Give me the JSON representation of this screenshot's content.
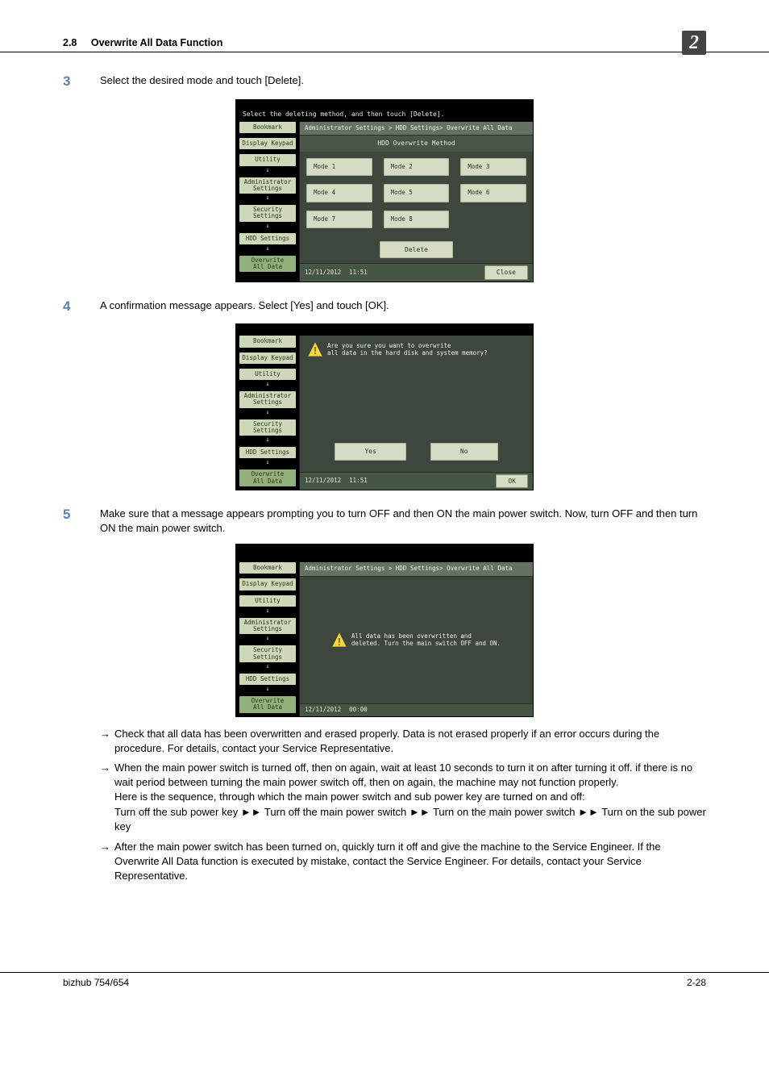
{
  "header": {
    "sec_number": "2.8",
    "sec_title": "Overwrite All Data Function",
    "badge": "2"
  },
  "steps": {
    "s3": {
      "num": "3",
      "text": "Select the desired mode and touch [Delete]."
    },
    "s4": {
      "num": "4",
      "text": "A confirmation message appears. Select [Yes] and touch [OK]."
    },
    "s5": {
      "num": "5",
      "text": "Make sure that a message appears prompting you to turn OFF and then ON the main power switch. Now, turn OFF and then turn ON the main power switch."
    }
  },
  "bullets": {
    "b1": "Check that all data has been overwritten and erased properly. Data is not erased properly if an error occurs during the procedure. For details, contact your Service Representative.",
    "b2a": "When the main power switch is turned off, then on again, wait at least 10 seconds to turn it on after turning it off. if there is no wait period between turning the main power switch off, then on again, the machine may not function properly.",
    "b2b": "Here is the sequence, through which the main power switch and sub power key are turned on and off:",
    "seq1": "Turn off the sub power key ",
    "seq2": " Turn off the main power switch ",
    "seq3": " Turn on the main power switch ",
    "seq4": " Turn on the sub power key",
    "b3": "After the main power switch has been turned on, quickly turn it off and give the machine to the Service Engineer. If the Overwrite All Data function is executed by mistake, contact the Service Engineer. For details, contact your Service Representative."
  },
  "screen1": {
    "instr": "Select the deleting method, and then touch [Delete].",
    "crumb": "Administrator Settings > HDD Settings> Overwrite All Data",
    "tab": "HDD Overwrite Method",
    "modes": [
      "Mode 1",
      "Mode 2",
      "Mode 3",
      "Mode 4",
      "Mode 5",
      "Mode 6",
      "Mode 7",
      "Mode 8"
    ],
    "delete": "Delete",
    "date": "12/11/2012",
    "time": "11:51",
    "close": "Close"
  },
  "side": {
    "bookmark": "Bookmark",
    "keypad": "Display Keypad",
    "utility": "Utility",
    "admin": "Administrator\nSettings",
    "security": "Security\nSettings",
    "hdd": "HDD Settings",
    "overwrite": "Overwrite\nAll Data"
  },
  "screen2": {
    "warn": "Are you sure you want to overwrite\nall data in the hard disk and system memory?",
    "yes": "Yes",
    "no": "No",
    "ok": "OK",
    "date": "12/11/2012",
    "time": "11:51"
  },
  "screen3": {
    "crumb": "Administrator Settings > HDD Settings> Overwrite All Data",
    "msg": "All data has been overwritten and\ndeleted. Turn the main switch OFF and ON.",
    "date": "12/11/2012",
    "time": "00:00"
  },
  "footer": {
    "left": "bizhub 754/654",
    "right": "2-28"
  }
}
